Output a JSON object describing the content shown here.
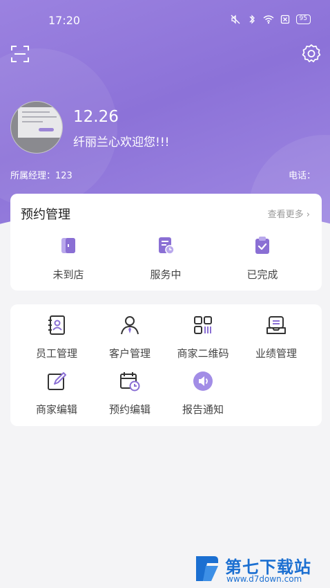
{
  "status_bar": {
    "time": "17:20",
    "battery": "95"
  },
  "colors": {
    "brand": "#8c72d8",
    "icon_purple": "#8a6fd4",
    "watermark_blue": "#1b6fd1"
  },
  "icons": {
    "scan": "scan-icon",
    "settings": "gear-icon"
  },
  "profile": {
    "name": "12.26",
    "welcome": "纤丽兰心欢迎您!!!",
    "manager": "所属经理：123",
    "phone": "电话："
  },
  "appointment": {
    "title": "预约管理",
    "more": "查看更多 ›",
    "items": [
      {
        "label": "未到店",
        "icon": "door-icon"
      },
      {
        "label": "服务中",
        "icon": "document-clock-icon"
      },
      {
        "label": "已完成",
        "icon": "clipboard-check-icon"
      }
    ]
  },
  "functions": {
    "items": [
      {
        "label": "员工管理",
        "icon": "staff-book-icon"
      },
      {
        "label": "客户管理",
        "icon": "customer-person-icon"
      },
      {
        "label": "商家二维码",
        "icon": "qrcode-icon"
      },
      {
        "label": "业绩管理",
        "icon": "performance-tray-icon"
      },
      {
        "label": "商家编辑",
        "icon": "edit-icon"
      },
      {
        "label": "预约编辑",
        "icon": "calendar-clock-icon"
      },
      {
        "label": "报告通知",
        "icon": "speaker-icon"
      }
    ]
  },
  "watermark": {
    "title": "第七下载站",
    "url": "www.d7down.com"
  }
}
